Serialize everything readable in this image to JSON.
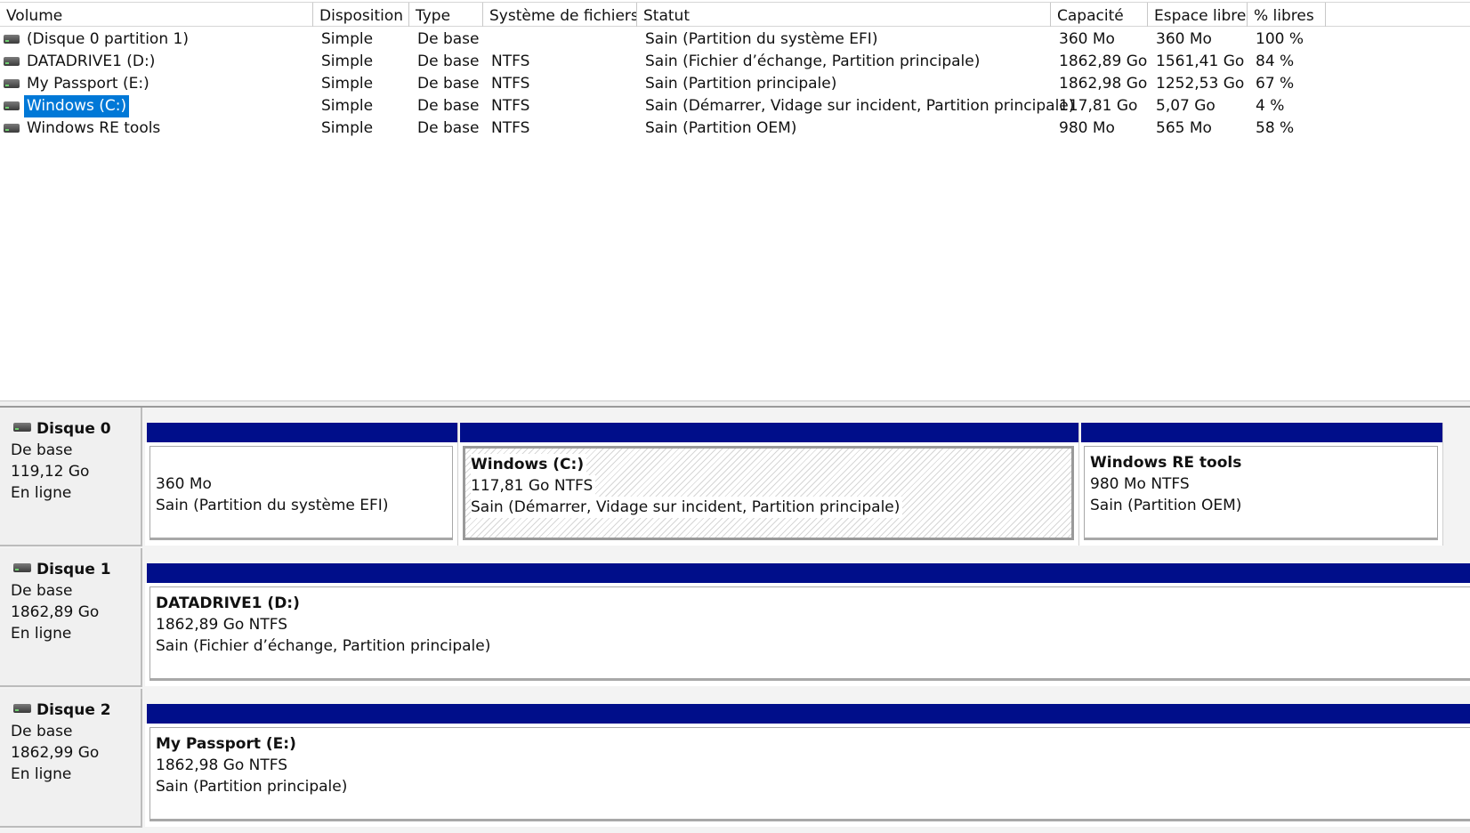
{
  "columns": [
    "Volume",
    "Disposition",
    "Type",
    "Système de fichiers",
    "Statut",
    "Capacité",
    "Espace libre",
    "% libres"
  ],
  "volumes": [
    {
      "name": "(Disque 0 partition 1)",
      "disposition": "Simple",
      "type": "De base",
      "fs": "",
      "status": "Sain (Partition du système EFI)",
      "capacity": "360 Mo",
      "free": "360 Mo",
      "pct": "100 %"
    },
    {
      "name": "DATADRIVE1 (D:)",
      "disposition": "Simple",
      "type": "De base",
      "fs": "NTFS",
      "status": "Sain (Fichier d’échange, Partition principale)",
      "capacity": "1862,89 Go",
      "free": "1561,41 Go",
      "pct": "84 %"
    },
    {
      "name": "My Passport (E:)",
      "disposition": "Simple",
      "type": "De base",
      "fs": "NTFS",
      "status": "Sain (Partition principale)",
      "capacity": "1862,98 Go",
      "free": "1252,53 Go",
      "pct": "67 %"
    },
    {
      "name": "Windows (C:)",
      "disposition": "Simple",
      "type": "De base",
      "fs": "NTFS",
      "status": "Sain (Démarrer, Vidage sur incident, Partition principale)",
      "capacity": "117,81 Go",
      "free": "5,07 Go",
      "pct": "4 %",
      "selected": true
    },
    {
      "name": "Windows RE tools",
      "disposition": "Simple",
      "type": "De base",
      "fs": "NTFS",
      "status": "Sain (Partition OEM)",
      "capacity": "980 Mo",
      "free": "565 Mo",
      "pct": "58 %"
    }
  ],
  "disks": [
    {
      "name": "Disque 0",
      "type": "De base",
      "size": "119,12 Go",
      "state": "En ligne",
      "partitions": [
        {
          "title": "",
          "size": "360 Mo",
          "status": "Sain (Partition du système EFI)"
        },
        {
          "title": "Windows  (C:)",
          "size": "117,81 Go NTFS",
          "status": "Sain (Démarrer, Vidage sur incident, Partition principale)"
        },
        {
          "title": "Windows RE tools",
          "size": "980 Mo NTFS",
          "status": "Sain (Partition OEM)"
        }
      ]
    },
    {
      "name": "Disque 1",
      "type": "De base",
      "size": "1862,89 Go",
      "state": "En ligne",
      "partitions": [
        {
          "title": "DATADRIVE1  (D:)",
          "size": "1862,89 Go NTFS",
          "status": "Sain (Fichier d’échange, Partition principale)"
        }
      ]
    },
    {
      "name": "Disque 2",
      "type": "De base",
      "size": "1862,99 Go",
      "state": "En ligne",
      "partitions": [
        {
          "title": "My Passport  (E:)",
          "size": "1862,98 Go NTFS",
          "status": "Sain (Partition principale)"
        }
      ]
    }
  ],
  "colors": {
    "partition_bar": "#000e8a",
    "selection": "#0078d7"
  }
}
